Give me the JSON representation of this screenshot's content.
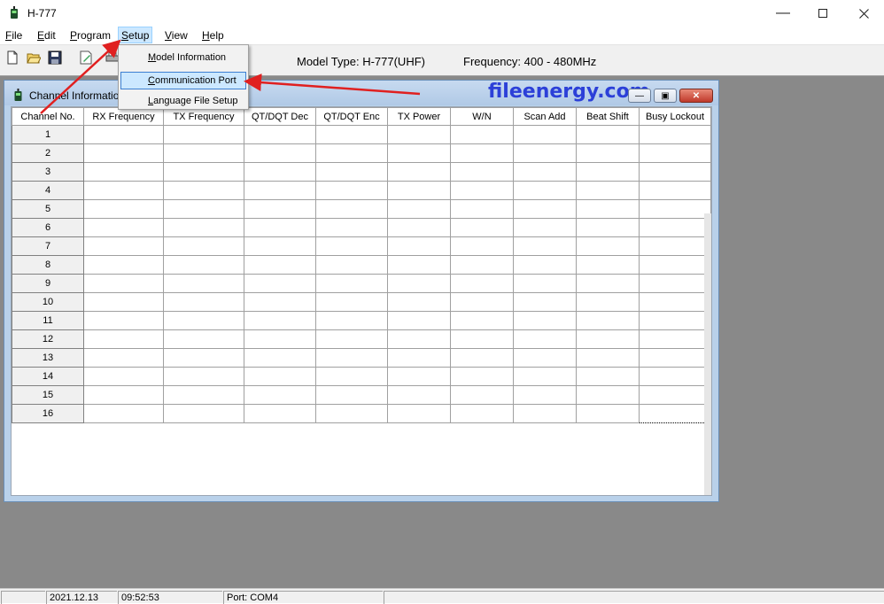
{
  "window": {
    "title": "H-777"
  },
  "menu": [
    {
      "label": "File",
      "accel": "F",
      "rest": "ile"
    },
    {
      "label": "Edit",
      "accel": "E",
      "rest": "dit"
    },
    {
      "label": "Program",
      "accel": "P",
      "rest": "rogram"
    },
    {
      "label": "Setup",
      "accel": "S",
      "rest": "etup"
    },
    {
      "label": "View",
      "accel": "V",
      "rest": "iew"
    },
    {
      "label": "Help",
      "accel": "H",
      "rest": "elp"
    }
  ],
  "setup_menu": {
    "items": [
      {
        "label": "Model Information",
        "accel": "M",
        "rest": "odel Information"
      },
      {
        "label": "Communication Port",
        "accel": "C",
        "rest": "ommunication Port"
      },
      {
        "label": "Language File Setup",
        "accel": "L",
        "rest": "anguage File Setup"
      }
    ]
  },
  "toolbar": {
    "model_type": "Model Type:  H-777(UHF)",
    "frequency": "Frequency:  400 - 480MHz"
  },
  "child_window": {
    "title": "Channel Informatio",
    "watermark": "fileenergy.com"
  },
  "grid": {
    "columns": [
      "Channel No.",
      "RX Frequency",
      "TX Frequency",
      "QT/DQT Dec",
      "QT/DQT Enc",
      "TX Power",
      "W/N",
      "Scan Add",
      "Beat Shift",
      "Busy Lockout"
    ],
    "rows": [
      "1",
      "2",
      "3",
      "4",
      "5",
      "6",
      "7",
      "8",
      "9",
      "10",
      "11",
      "12",
      "13",
      "14",
      "15",
      "16"
    ]
  },
  "statusbar": {
    "date": "2021.12.13",
    "time": "09:52:53",
    "port": "Port: COM4"
  },
  "colors": {
    "highlight": "#cce8ff",
    "workspace": "#898989",
    "watermark": "#2c40d8",
    "arrow": "#e02020"
  }
}
